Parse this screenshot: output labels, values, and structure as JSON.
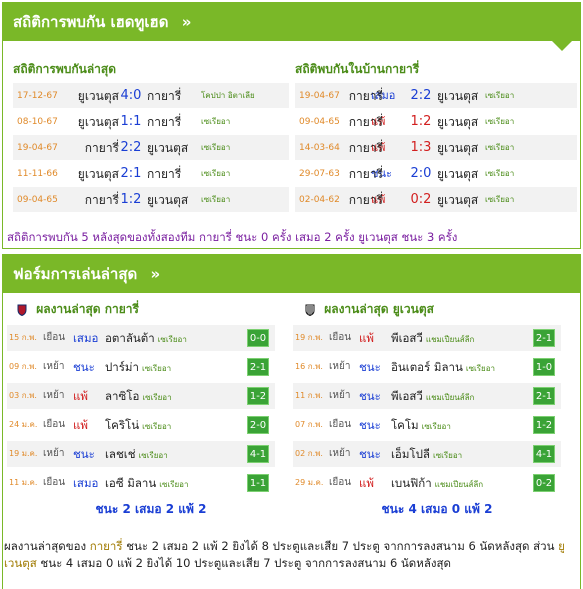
{
  "h2h": {
    "title": "สถิติการพบกัน เฮดทูเฮด",
    "left_heading": "สถิติการพบกันล่าสุด",
    "right_heading": "สถิติพบกันในบ้านกายารี่",
    "left_rows": [
      {
        "date": "17-12-67",
        "home": "ยูเวนตุส",
        "score": "4:0",
        "away": "กายารี่",
        "league": "โคปปา อิตาเลีย",
        "prefix": "",
        "color": "blue"
      },
      {
        "date": "08-10-67",
        "home": "ยูเวนตุส",
        "score": "1:1",
        "away": "กายารี่",
        "league": "เซเรียอา",
        "prefix": "",
        "color": "blue"
      },
      {
        "date": "19-04-67",
        "home": "กายารี่",
        "score": "2:2",
        "away": "ยูเวนตุส",
        "league": "เซเรียอา",
        "prefix": "",
        "color": "blue"
      },
      {
        "date": "11-11-66",
        "home": "ยูเวนตุส",
        "score": "2:1",
        "away": "กายารี่",
        "league": "เซเรียอา",
        "prefix": "",
        "color": "blue"
      },
      {
        "date": "09-04-65",
        "home": "กายารี่",
        "score": "1:2",
        "away": "ยูเวนตุส",
        "league": "เซเรียอา",
        "prefix": "",
        "color": "blue"
      }
    ],
    "right_rows": [
      {
        "date": "19-04-67",
        "home": "กายารี่",
        "score": "2:2",
        "away": "ยูเวนตุส",
        "league": "เซเรียอา",
        "prefix": "เสมอ",
        "color": "blue"
      },
      {
        "date": "09-04-65",
        "home": "กายารี่",
        "score": "1:2",
        "away": "ยูเวนตุส",
        "league": "เซเรียอา",
        "prefix": "แพ้",
        "color": "red"
      },
      {
        "date": "14-03-64",
        "home": "กายารี่",
        "score": "1:3",
        "away": "ยูเวนตุส",
        "league": "เซเรียอา",
        "prefix": "แพ้",
        "color": "red"
      },
      {
        "date": "29-07-63",
        "home": "กายารี่",
        "score": "2:0",
        "away": "ยูเวนตุส",
        "league": "เซเรียอา",
        "prefix": "ชนะ",
        "color": "blue"
      },
      {
        "date": "02-04-62",
        "home": "กายารี่",
        "score": "0:2",
        "away": "ยูเวนตุส",
        "league": "เซเรียอา",
        "prefix": "แพ้",
        "color": "red"
      }
    ],
    "summary": "สถิติการพบกัน 5 หลังสุดของทั้งสองทีม กายารี่ ชนะ 0 ครั้ง เสมอ 2 ครั้ง ยูเวนตุส ชนะ 3 ครั้ง"
  },
  "form": {
    "title": "ฟอร์มการเล่นล่าสุด",
    "left_heading": "ผลงานล่าสุด กายารี่",
    "right_heading": "ผลงานล่าสุด ยูเวนตุส",
    "left_rows": [
      {
        "date": "15 ก.พ.",
        "ha": "เยือน",
        "result": "เสมอ",
        "color": "blue",
        "opponent": "อตาลันต้า",
        "league": "เซเรียอา",
        "score": "0-0"
      },
      {
        "date": "09 ก.พ.",
        "ha": "เหย้า",
        "result": "ชนะ",
        "color": "blue",
        "opponent": "ปาร์ม่า",
        "league": "เซเรียอา",
        "score": "2-1"
      },
      {
        "date": "03 ก.พ.",
        "ha": "เหย้า",
        "result": "แพ้",
        "color": "red",
        "opponent": "ลาซิโอ",
        "league": "เซเรียอา",
        "score": "1-2"
      },
      {
        "date": "24 ม.ค.",
        "ha": "เยือน",
        "result": "แพ้",
        "color": "red",
        "opponent": "โคริโน่",
        "league": "เซเรียอา",
        "score": "2-0"
      },
      {
        "date": "19 ม.ค.",
        "ha": "เหย้า",
        "result": "ชนะ",
        "color": "blue",
        "opponent": "เลชเช่",
        "league": "เซเรียอา",
        "score": "4-1"
      },
      {
        "date": "11 ม.ค.",
        "ha": "เยือน",
        "result": "เสมอ",
        "color": "blue",
        "opponent": "เอซี มิลาน",
        "league": "เซเรียอา",
        "score": "1-1"
      }
    ],
    "right_rows": [
      {
        "date": "19 ก.พ.",
        "ha": "เยือน",
        "result": "แพ้",
        "color": "red",
        "opponent": "พีเอสวี",
        "league": "แชมเปียนส์ลีก",
        "score": "2-1"
      },
      {
        "date": "16 ก.พ.",
        "ha": "เหย้า",
        "result": "ชนะ",
        "color": "blue",
        "opponent": "อินเตอร์ มิลาน",
        "league": "เซเรียอา",
        "score": "1-0"
      },
      {
        "date": "11 ก.พ.",
        "ha": "เหย้า",
        "result": "ชนะ",
        "color": "blue",
        "opponent": "พีเอสวี",
        "league": "แชมเปียนส์ลีก",
        "score": "2-1"
      },
      {
        "date": "07 ก.พ.",
        "ha": "เยือน",
        "result": "ชนะ",
        "color": "blue",
        "opponent": "โคโม",
        "league": "เซเรียอา",
        "score": "1-2"
      },
      {
        "date": "02 ก.พ.",
        "ha": "เหย้า",
        "result": "ชนะ",
        "color": "blue",
        "opponent": "เอ็มโปลี",
        "league": "เซเรียอา",
        "score": "4-1"
      },
      {
        "date": "29 ม.ค.",
        "ha": "เยือน",
        "result": "แพ้",
        "color": "red",
        "opponent": "เบนฟิก้า",
        "league": "แชมเปียนส์ลีก",
        "score": "0-2"
      }
    ],
    "left_total": "ชนะ 2 เสมอ 2 แพ้ 2",
    "right_total": "ชนะ 4 เสมอ 0 แพ้ 2"
  },
  "bottom": {
    "p1": "ผลงานล่าสุดของ ",
    "team1": "กายารี่",
    "p2": " ชนะ 2 เสมอ 2 แพ้ 2 ยิงได้ 8 ประตูและเสีย 7 ประตู จากการลงสนาม 6 นัดหลังสุด ส่วน ",
    "team2": "ยูเวนตุส",
    "p3": " ชนะ 4 เสมอ 0 แพ้ 2 ยิงได้ 10 ประตูและเสีย 7 ประตู จากการลงสนาม 6 นัดหลังสุด"
  },
  "colors": {
    "accent": "#7ab828",
    "blue": "#1a3ed4",
    "red": "#d21f1f",
    "date": "#e08a2a",
    "badge": "#3aa336"
  },
  "icons": {
    "chevron": "double-chevron-right-icon",
    "left_club": "cagliari-crest-icon",
    "right_club": "juventus-crest-icon"
  }
}
